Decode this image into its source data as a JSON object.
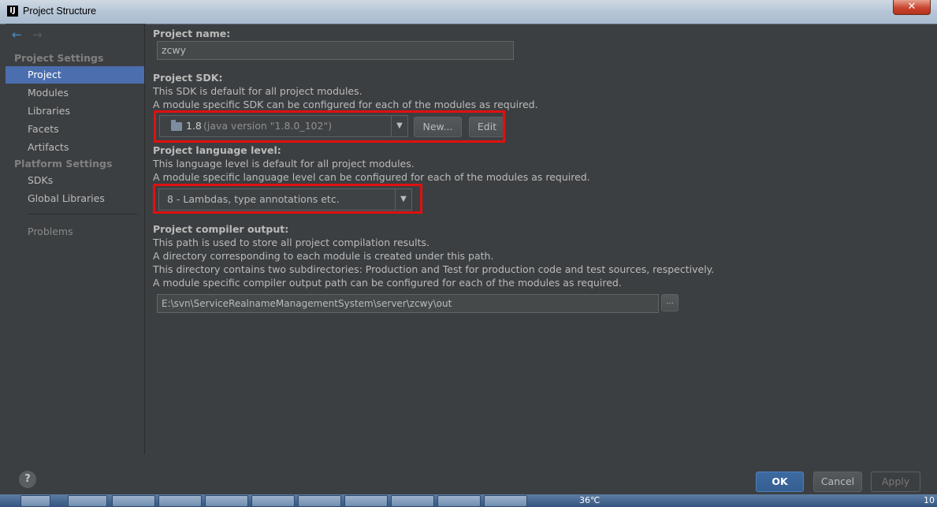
{
  "window": {
    "title": "Project Structure",
    "app_icon": "intellij-icon",
    "close_label": "✕"
  },
  "sidebar": {
    "back_icon": "←",
    "forward_icon": "→",
    "section_project_settings": "Project Settings",
    "section_platform_settings": "Platform Settings",
    "items": {
      "project": "Project",
      "modules": "Modules",
      "libraries": "Libraries",
      "facets": "Facets",
      "artifacts": "Artifacts",
      "sdks": "SDKs",
      "global_libraries": "Global Libraries",
      "problems": "Problems"
    },
    "selected": "Project"
  },
  "main": {
    "project_name": {
      "label": "Project name:",
      "value": "zcwy"
    },
    "project_sdk": {
      "label": "Project SDK:",
      "desc1": "This SDK is default for all project modules.",
      "desc2": "A module specific SDK can be configured for each of the modules as required.",
      "sdk_version": "1.8",
      "sdk_detail": "(java version \"1.8.0_102\")",
      "new_button": "New...",
      "edit_button": "Edit"
    },
    "language_level": {
      "label": "Project language level:",
      "desc1": "This language level is default for all project modules.",
      "desc2": "A module specific language level can be configured for each of the modules as required.",
      "value": "8 - Lambdas, type annotations etc."
    },
    "compiler_output": {
      "label": "Project compiler output:",
      "desc1": "This path is used to store all project compilation results.",
      "desc2": "A directory corresponding to each module is created under this path.",
      "desc3": "This directory contains two subdirectories: Production and Test for production code and test sources, respectively.",
      "desc4": "A module specific compiler output path can be configured for each of the modules as required.",
      "path": "E:\\svn\\ServiceRealnameManagementSystem\\server\\zcwy\\out",
      "browse_button": "..."
    }
  },
  "footer": {
    "help": "?",
    "ok": "OK",
    "cancel": "Cancel",
    "apply": "Apply"
  },
  "taskbar": {
    "temperature": "36℃",
    "clock": "10"
  },
  "colors": {
    "accent": "#4b6eaf",
    "highlight": "#e01010",
    "background": "#3c3f41"
  }
}
